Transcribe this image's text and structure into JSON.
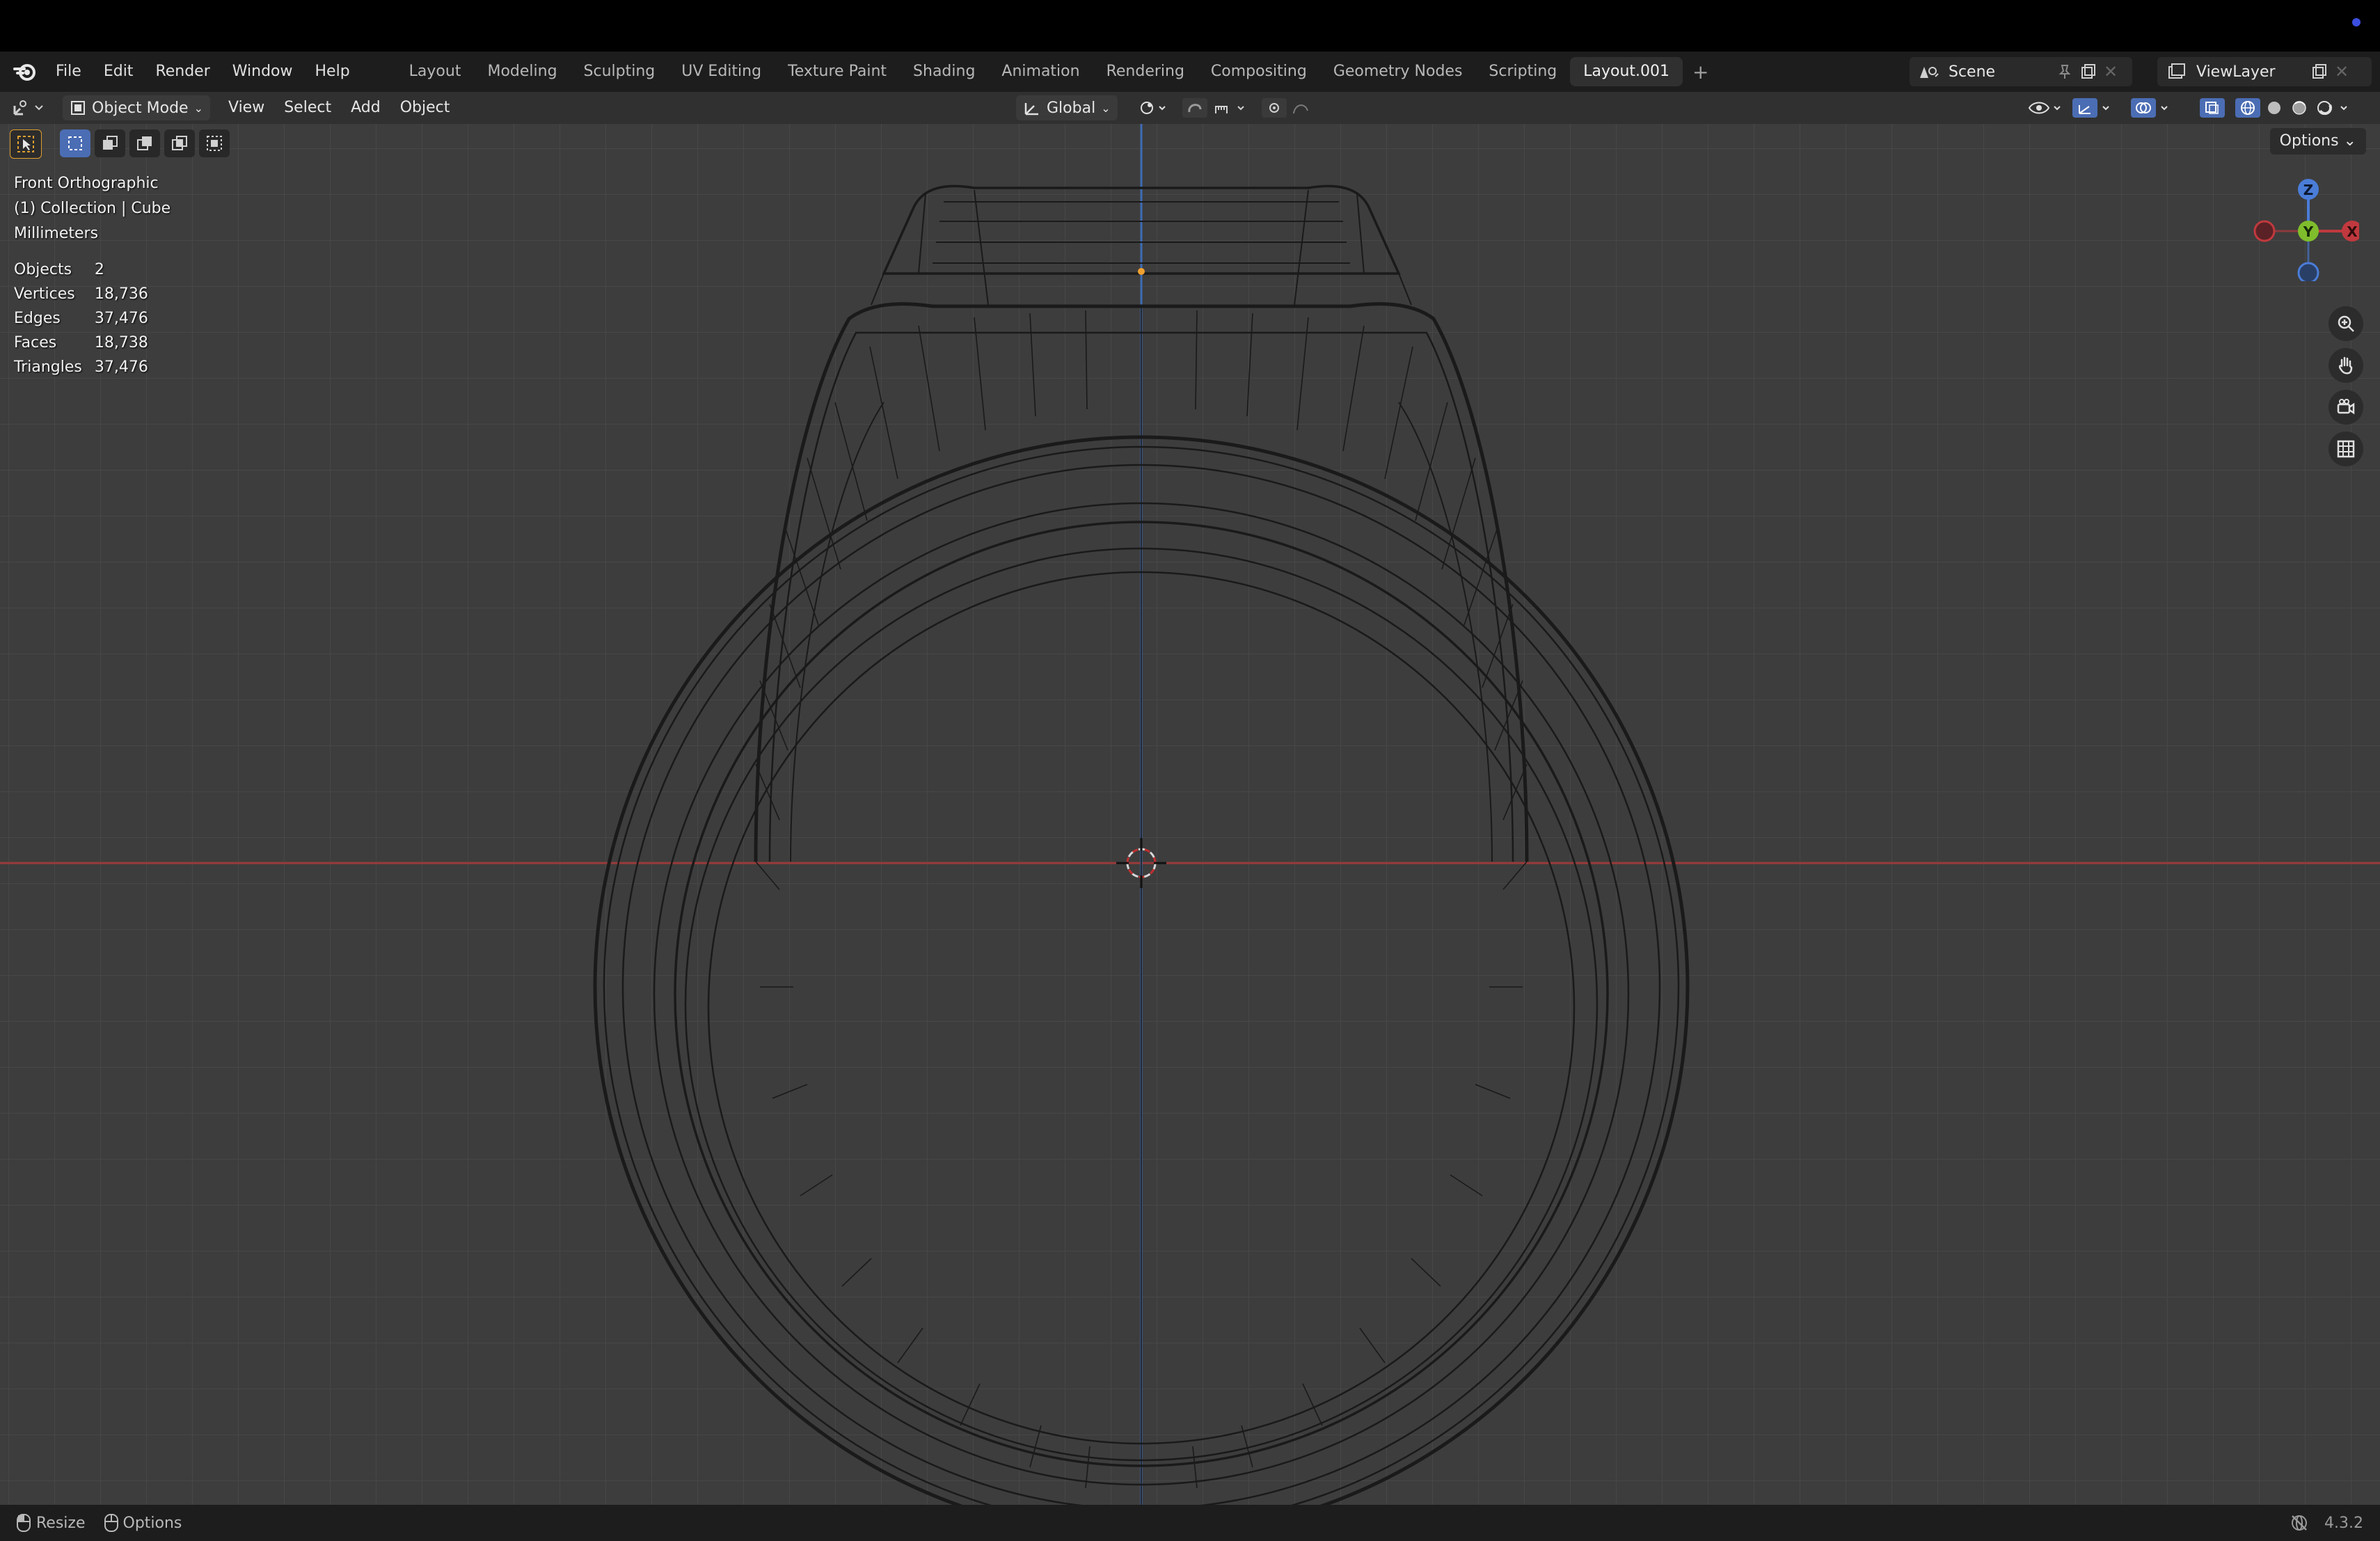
{
  "menu": {
    "items": [
      "File",
      "Edit",
      "Render",
      "Window",
      "Help"
    ]
  },
  "workspaces": {
    "tabs": [
      "Layout",
      "Modeling",
      "Sculpting",
      "UV Editing",
      "Texture Paint",
      "Shading",
      "Animation",
      "Rendering",
      "Compositing",
      "Geometry Nodes",
      "Scripting",
      "Layout.001"
    ],
    "active": "Layout.001"
  },
  "scene": {
    "name": "Scene"
  },
  "view_layer": {
    "name": "ViewLayer"
  },
  "header": {
    "mode": "Object Mode",
    "menus": [
      "View",
      "Select",
      "Add",
      "Object"
    ],
    "transform_orientation": "Global"
  },
  "viewport": {
    "view_name": "Front Orthographic",
    "collection": "(1) Collection | Cube",
    "units": "Millimeters",
    "options_label": "Options",
    "stats": [
      {
        "label": "Objects",
        "value": "2"
      },
      {
        "label": "Vertices",
        "value": "18,736"
      },
      {
        "label": "Edges",
        "value": "37,476"
      },
      {
        "label": "Faces",
        "value": "18,738"
      },
      {
        "label": "Triangles",
        "value": "37,476"
      }
    ],
    "gizmo": {
      "z": "Z",
      "y": "Y",
      "x": "X"
    }
  },
  "statusbar": {
    "resize": "Resize",
    "options": "Options",
    "version": "4.3.2"
  },
  "colors": {
    "axis_x": "#c0393e",
    "axis_z": "#4a7dd8",
    "axis_y": "#7fbd2c",
    "selection_blue": "#4b6db4"
  }
}
